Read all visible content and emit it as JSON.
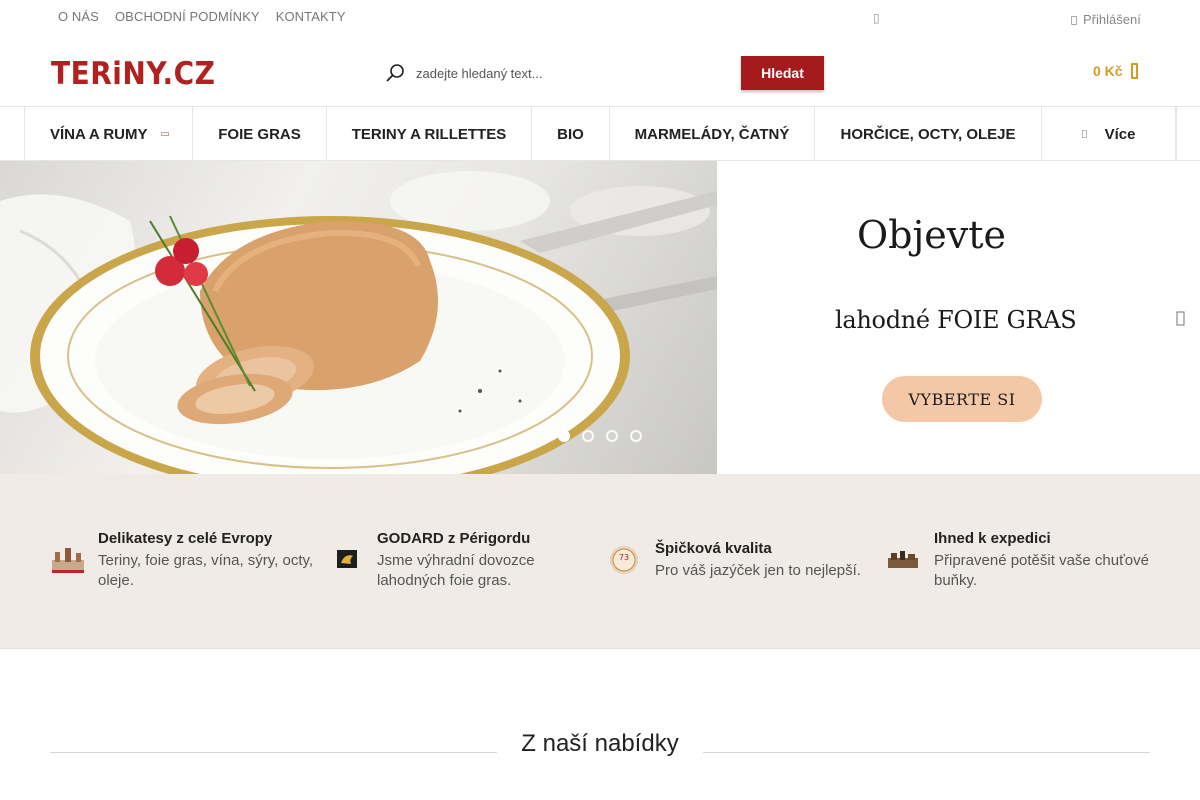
{
  "top_links": [
    "O NÁS",
    "OBCHODNÍ PODMÍNKY",
    "KONTAKTY"
  ],
  "login_label": "Přihlášení",
  "logo_text": "TERiNY.CZ",
  "search": {
    "placeholder": "zadejte hledaný text...",
    "button_label": "Hledat"
  },
  "cart": {
    "amount": "0 Kč"
  },
  "nav": {
    "items": [
      "VÍNA A RUMY",
      "FOIE GRAS",
      "TERINY A RILLETTES",
      "BIO",
      "MARMELÁDY, ČATNÝ",
      "HORČICE, OCTY, OLEJE"
    ],
    "more_label": "Více"
  },
  "hero": {
    "headline": "Objevte",
    "subline": "lahodné FOIE GRAS",
    "cta_label": "VYBERTE SI",
    "slide_count": 4,
    "active_slide": 1
  },
  "benefits": [
    {
      "title": "Delikatesy z celé Evropy",
      "text": "Teriny, foie gras, vína, sýry, octy, oleje."
    },
    {
      "title": "GODARD z Périgordu",
      "text": "Jsme výhradní dovozce lahodných foie gras."
    },
    {
      "title": "Špičková kvalita",
      "text": "Pro váš jazýček jen to nejlepší."
    },
    {
      "title": "Ihned k expedici",
      "text": "Připravené potěšit vaše chuťové buňky."
    }
  ],
  "badge_text": "73",
  "section_title": "Z naší nabídky",
  "colors": {
    "brand_red": "#a41a1d",
    "cart_gold": "#d79a1e",
    "benefits_bg": "#f1ebe7",
    "cta_peach": "#f4c8a6"
  }
}
